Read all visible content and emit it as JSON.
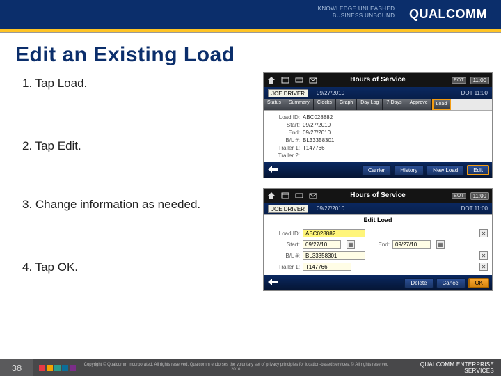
{
  "brand": {
    "tagline_l1": "KNOWLEDGE UNLEASHED.",
    "tagline_l2": "BUSINESS UNBOUND.",
    "logo_text": "QUALCOMM"
  },
  "title": "Edit an Existing Load",
  "steps": [
    "1.  Tap Load.",
    "2.  Tap Edit.",
    "3.  Change information as needed.",
    "4.  Tap OK."
  ],
  "shot1": {
    "top_title": "Hours of Service",
    "eot": "EOT",
    "clock": "11:00",
    "user": "JOE DRIVER",
    "date": "09/27/2010",
    "dot": "DOT 11:00",
    "tabs": [
      "Status",
      "Summary",
      "Clocks",
      "Graph",
      "Day Log",
      "7-Days",
      "Approve",
      "Load"
    ],
    "fields": [
      {
        "label": "Load ID:",
        "value": "ABC028882"
      },
      {
        "label": "Start:",
        "value": "09/27/2010"
      },
      {
        "label": "End:",
        "value": "09/27/2010"
      },
      {
        "label": "B/L #:",
        "value": "BL33358301"
      },
      {
        "label": "Trailer 1:",
        "value": "T147766"
      },
      {
        "label": "Trailer 2:",
        "value": ""
      }
    ],
    "bottom_buttons": [
      "Carrier",
      "History",
      "New Load",
      "Edit"
    ]
  },
  "shot2": {
    "top_title": "Hours of Service",
    "eot": "EOT",
    "clock": "11:00",
    "user": "JOE DRIVER",
    "date": "09/27/2010",
    "dot": "DOT 11:00",
    "subtitle": "Edit Load",
    "load_id_label": "Load ID:",
    "load_id_value": "ABC028882",
    "start_label": "Start:",
    "start_value": "09/27/10",
    "end_label": "End:",
    "end_value": "09/27/10",
    "bl_label": "B/L #:",
    "bl_value": "BL33358301",
    "trailer1_label": "Trailer 1:",
    "trailer1_value": "T147766",
    "x": "✕",
    "bottom_buttons": [
      "Delete",
      "Cancel",
      "OK"
    ]
  },
  "footer": {
    "page": "38",
    "copy": "Copyright © Qualcomm Incorporated. All rights reserved. Qualcomm endorses the voluntary set of privacy principles for location-based services. © All rights reserved 2010.",
    "logo": "QUALCOMM ENTERPRISE SERVICES",
    "colors": [
      "#e63946",
      "#f4a300",
      "#2a9d8f",
      "#0b6e99",
      "#7b2d89"
    ]
  }
}
